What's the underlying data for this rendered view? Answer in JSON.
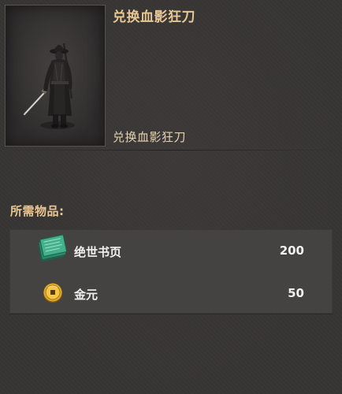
{
  "dialog": {
    "title": "兑换血影狂刀",
    "reward_name": "兑换血影狂刀",
    "requirements_label": "所需物品:"
  },
  "requirements": [
    {
      "name": "绝世书页",
      "quantity": "200",
      "icon": "jade-book-pages-icon"
    },
    {
      "name": "金元",
      "quantity": "50",
      "icon": "gold-coin-icon"
    }
  ],
  "colors": {
    "title": "#e8c792",
    "background": "#373534",
    "list_background": "#454242",
    "text": "#f1f1ee"
  }
}
